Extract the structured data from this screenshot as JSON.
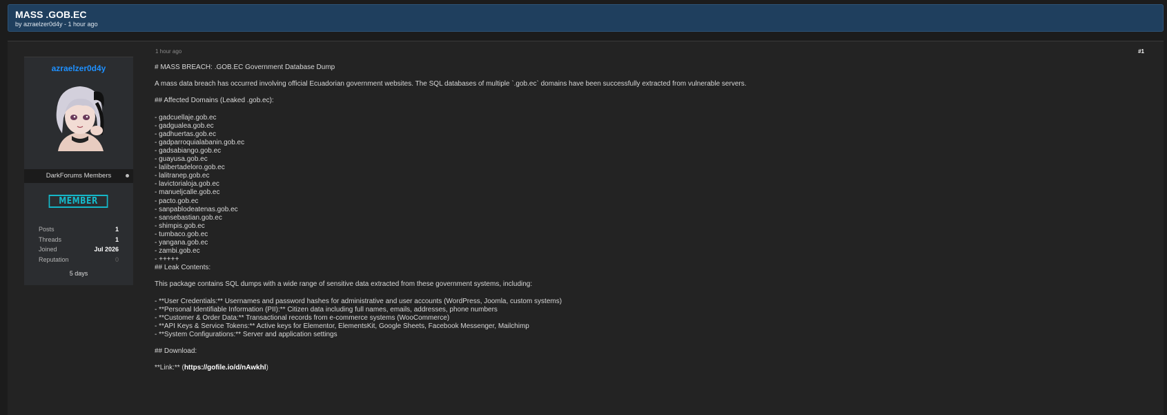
{
  "thread": {
    "title": "MASS .GOB.EC",
    "meta": "by azraelzer0d4y - 1 hour ago"
  },
  "author": {
    "username": "azraelzer0d4y",
    "group": "DarkForums Members",
    "rank": "MEMBER",
    "stats": [
      {
        "label": "Posts",
        "value": "1"
      },
      {
        "label": "Threads",
        "value": "1"
      },
      {
        "label": "Joined",
        "value": "Jul 2026"
      },
      {
        "label": "Reputation",
        "value": "0"
      }
    ],
    "stat_sub": "5 days",
    "colors": {
      "username": "#1e90ff",
      "rank": "#15b8c9"
    }
  },
  "post": {
    "date": "1 hour ago",
    "number": "#1",
    "heading": "# MASS BREACH: .GOB.EC Government Database Dump",
    "intro": "A mass data breach has occurred involving official Ecuadorian government websites. The SQL databases of multiple `.gob.ec` domains have been successfully extracted from vulnerable servers.",
    "domains_heading": "## Affected Domains (Leaked .gob.ec):",
    "domains": [
      "- gadcuellaje.gob.ec",
      "- gadgualea.gob.ec",
      "- gadhuertas.gob.ec",
      "- gadparroquialabanin.gob.ec",
      "- gadsabiango.gob.ec",
      "- guayusa.gob.ec",
      "- lalibertadeloro.gob.ec",
      "- lalitranep.gob.ec",
      "- lavictorialoja.gob.ec",
      "- manueljcalle.gob.ec",
      "- pacto.gob.ec",
      "- sanpablodeatenas.gob.ec",
      "- sansebastian.gob.ec",
      "- shimpis.gob.ec",
      "- tumbaco.gob.ec",
      "- yangana.gob.ec",
      "- zambi.gob.ec",
      "- +++++"
    ],
    "contents_heading": "## Leak Contents:",
    "contents_intro": "This package contains SQL dumps with a wide range of sensitive data extracted from these government systems, including:",
    "contents": [
      "- **User Credentials:** Usernames and password hashes for administrative and user accounts (WordPress, Joomla, custom systems)",
      "- **Personal Identifiable Information (PII):** Citizen data including full names, emails, addresses, phone numbers",
      "- **Customer & Order Data:** Transactional records from e-commerce systems (WooCommerce)",
      "- **API Keys & Service Tokens:** Active keys for Elementor, ElementsKit, Google Sheets, Facebook Messenger, Mailchimp",
      "- **System Configurations:** Server and application settings"
    ],
    "download_heading": "## Download:",
    "link_prefix": "**Link:** (",
    "link_text": "https://gofile.io/d/nAwkhl",
    "link_suffix": ")"
  }
}
